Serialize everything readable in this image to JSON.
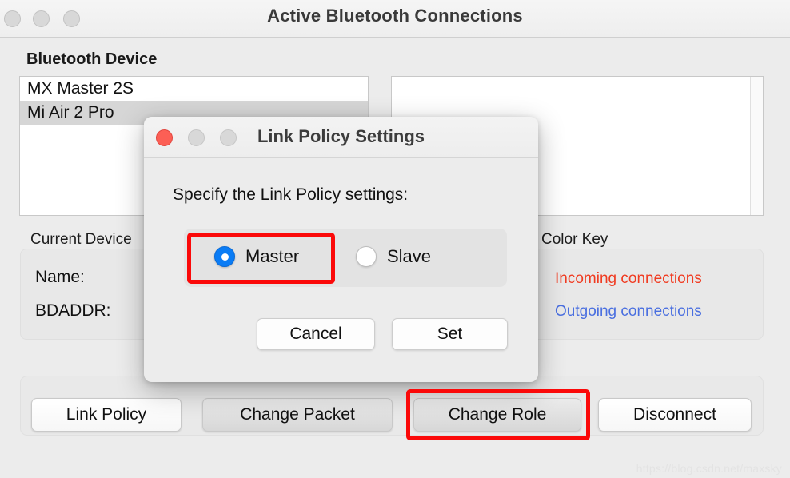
{
  "window": {
    "title": "Active Bluetooth Connections",
    "traffic_lights": [
      "close",
      "minimize",
      "maximize"
    ]
  },
  "device_section": {
    "heading": "Bluetooth Device",
    "items": [
      {
        "label": "MX Master 2S",
        "selected": false
      },
      {
        "label": "Mi Air 2 Pro",
        "selected": true
      }
    ]
  },
  "current_device": {
    "label": "Current Device",
    "name_label": "Name:",
    "name_value": "",
    "bdaddr_label": "BDADDR:",
    "bdaddr_value": ""
  },
  "color_key": {
    "label": "Color Key",
    "incoming": "Incoming connections",
    "outgoing": "Outgoing connections",
    "incoming_color": "#f03b21",
    "outgoing_color": "#4a6fe0"
  },
  "toolbar": {
    "link_policy": "Link Policy",
    "change_packet": "Change Packet",
    "change_role": "Change Role",
    "disconnect": "Disconnect"
  },
  "dialog": {
    "title": "Link Policy Settings",
    "prompt": "Specify the Link Policy settings:",
    "options": [
      {
        "label": "Master",
        "selected": true
      },
      {
        "label": "Slave",
        "selected": false
      }
    ],
    "cancel_label": "Cancel",
    "set_label": "Set"
  },
  "annotations": {
    "color": "#fb0909",
    "highlighted": [
      "Master",
      "Change Role"
    ]
  },
  "watermark": "https://blog.csdn.net/maxsky"
}
